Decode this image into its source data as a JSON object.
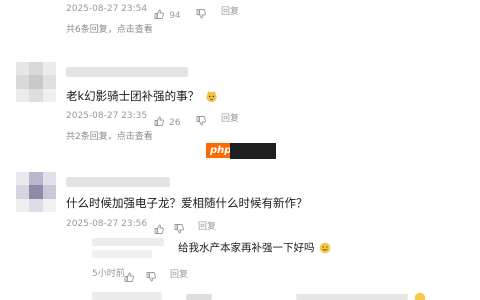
{
  "comments": [
    {
      "id": "c1",
      "text": "",
      "date": "2025-08-27 23:54",
      "likes": "94",
      "reply_label": "回复",
      "replies_summary": "共6条回复，点击查看"
    },
    {
      "id": "c2",
      "text": "老k幻影骑士团补强的事？",
      "emoji": "emoji",
      "date": "2025-08-27 23:35",
      "likes": "26",
      "reply_label": "回复",
      "replies_summary": "共2条回复，点击查看"
    },
    {
      "id": "c3",
      "text": "什么时候加强电子龙？爱相随什么时候有新作？",
      "date": "2025-08-27 23:56",
      "likes": "",
      "reply_label": "回复"
    }
  ],
  "replies": [
    {
      "id": "r1",
      "text": "给我水产本家再补强一下好吗",
      "emoji": "smile",
      "time": "5小时前",
      "reply_label": "回复"
    }
  ],
  "watermark": {
    "label": "php"
  },
  "colors": {
    "accent": "#ff6a00",
    "meta_text": "#9a9a9a",
    "body_text": "#1a1a1a"
  }
}
